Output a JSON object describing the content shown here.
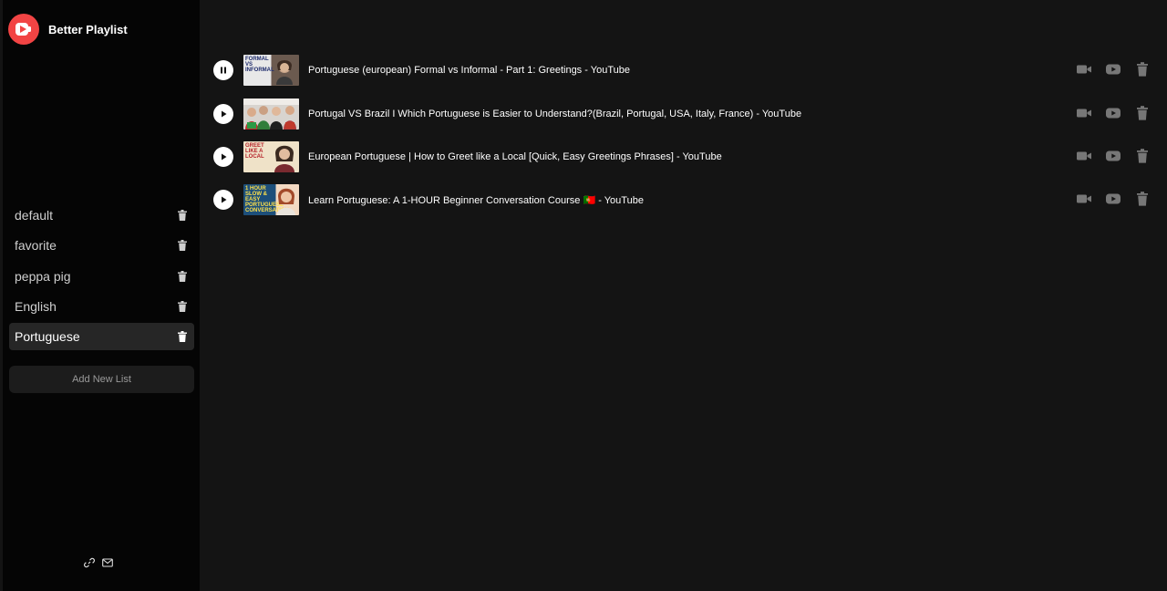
{
  "app": {
    "name": "Better Playlist"
  },
  "colors": {
    "accent": "#f24444",
    "background": "#141414",
    "sidebar": "#050505"
  },
  "sidebar": {
    "lists": [
      {
        "label": "default"
      },
      {
        "label": "favorite"
      },
      {
        "label": "peppa pig"
      },
      {
        "label": "English"
      },
      {
        "label": "Portuguese",
        "active": true
      }
    ],
    "add_label": "Add New List",
    "footer_icons": [
      "link-icon",
      "mail-icon"
    ]
  },
  "tracks": [
    {
      "title": "Portuguese (european) Formal vs Informal - Part 1: Greetings - YouTube",
      "state": "playing",
      "thumb_text": "FORMAL VS INFORMAL"
    },
    {
      "title": "Portugal VS Brazil I Which Portuguese is Easier to Understand?(Brazil, Portugal, USA, Italy, France) - YouTube",
      "state": "paused",
      "thumb_text": ""
    },
    {
      "title": "European Portuguese | How to Greet like a Local [Quick, Easy Greetings Phrases] - YouTube",
      "state": "paused",
      "thumb_text": "GREET LIKE A LOCAL"
    },
    {
      "title": "Learn Portuguese: A 1-HOUR Beginner Conversation Course 🇵🇹 - YouTube",
      "state": "paused",
      "thumb_text": "1 HOUR SLOW & EASY PORTUGUESE CONVERSATION"
    }
  ],
  "track_actions": [
    "video-camera-icon",
    "youtube-icon",
    "trash-icon"
  ]
}
